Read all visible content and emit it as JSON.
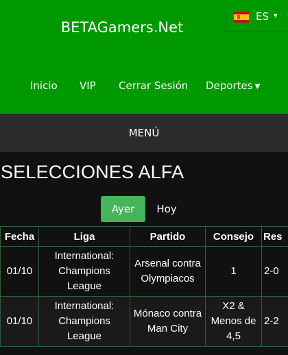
{
  "header": {
    "site_title": "BETAGamers.Net",
    "language": {
      "code": "ES",
      "flag": "spain-flag-icon"
    },
    "nav": [
      {
        "label": "Inicio"
      },
      {
        "label": "VIP"
      },
      {
        "label": "Cerrar Sesión"
      },
      {
        "label": "Deportes",
        "has_dropdown": true
      }
    ],
    "accent_color": "#009900"
  },
  "menu_bar": {
    "label": "MENÚ"
  },
  "section": {
    "title": "SELECCIONES ALFA",
    "tabs": [
      {
        "label": "Ayer",
        "active": true
      },
      {
        "label": "Hoy",
        "active": false
      }
    ]
  },
  "table": {
    "headers": [
      "Fecha",
      "Liga",
      "Partido",
      "Consejo",
      "Res"
    ],
    "rows": [
      {
        "fecha": "01/10",
        "liga": "International: Champions League",
        "partido": "Arsenal contra Olympiacos",
        "consejo": "1",
        "res": "2-0"
      },
      {
        "fecha": "01/10",
        "liga": "International: Champions League",
        "partido": "Mónaco contra Man City",
        "consejo": "X2 & Menos de 4,5",
        "res": "2-2"
      }
    ]
  }
}
